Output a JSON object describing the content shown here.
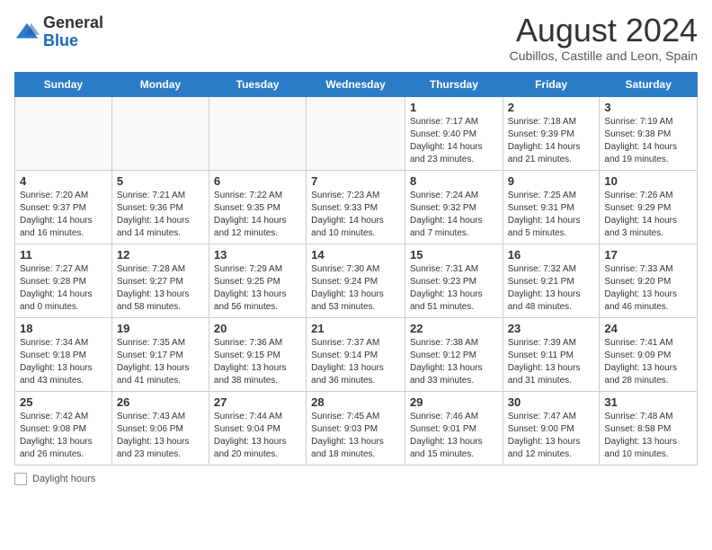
{
  "header": {
    "logo_general": "General",
    "logo_blue": "Blue",
    "month_year": "August 2024",
    "location": "Cubillos, Castille and Leon, Spain"
  },
  "days_of_week": [
    "Sunday",
    "Monday",
    "Tuesday",
    "Wednesday",
    "Thursday",
    "Friday",
    "Saturday"
  ],
  "weeks": [
    [
      {
        "day": "",
        "sunrise": "",
        "sunset": "",
        "daylight": ""
      },
      {
        "day": "",
        "sunrise": "",
        "sunset": "",
        "daylight": ""
      },
      {
        "day": "",
        "sunrise": "",
        "sunset": "",
        "daylight": ""
      },
      {
        "day": "",
        "sunrise": "",
        "sunset": "",
        "daylight": ""
      },
      {
        "day": "1",
        "sunrise": "Sunrise: 7:17 AM",
        "sunset": "Sunset: 9:40 PM",
        "daylight": "Daylight: 14 hours and 23 minutes."
      },
      {
        "day": "2",
        "sunrise": "Sunrise: 7:18 AM",
        "sunset": "Sunset: 9:39 PM",
        "daylight": "Daylight: 14 hours and 21 minutes."
      },
      {
        "day": "3",
        "sunrise": "Sunrise: 7:19 AM",
        "sunset": "Sunset: 9:38 PM",
        "daylight": "Daylight: 14 hours and 19 minutes."
      }
    ],
    [
      {
        "day": "4",
        "sunrise": "Sunrise: 7:20 AM",
        "sunset": "Sunset: 9:37 PM",
        "daylight": "Daylight: 14 hours and 16 minutes."
      },
      {
        "day": "5",
        "sunrise": "Sunrise: 7:21 AM",
        "sunset": "Sunset: 9:36 PM",
        "daylight": "Daylight: 14 hours and 14 minutes."
      },
      {
        "day": "6",
        "sunrise": "Sunrise: 7:22 AM",
        "sunset": "Sunset: 9:35 PM",
        "daylight": "Daylight: 14 hours and 12 minutes."
      },
      {
        "day": "7",
        "sunrise": "Sunrise: 7:23 AM",
        "sunset": "Sunset: 9:33 PM",
        "daylight": "Daylight: 14 hours and 10 minutes."
      },
      {
        "day": "8",
        "sunrise": "Sunrise: 7:24 AM",
        "sunset": "Sunset: 9:32 PM",
        "daylight": "Daylight: 14 hours and 7 minutes."
      },
      {
        "day": "9",
        "sunrise": "Sunrise: 7:25 AM",
        "sunset": "Sunset: 9:31 PM",
        "daylight": "Daylight: 14 hours and 5 minutes."
      },
      {
        "day": "10",
        "sunrise": "Sunrise: 7:26 AM",
        "sunset": "Sunset: 9:29 PM",
        "daylight": "Daylight: 14 hours and 3 minutes."
      }
    ],
    [
      {
        "day": "11",
        "sunrise": "Sunrise: 7:27 AM",
        "sunset": "Sunset: 9:28 PM",
        "daylight": "Daylight: 14 hours and 0 minutes."
      },
      {
        "day": "12",
        "sunrise": "Sunrise: 7:28 AM",
        "sunset": "Sunset: 9:27 PM",
        "daylight": "Daylight: 13 hours and 58 minutes."
      },
      {
        "day": "13",
        "sunrise": "Sunrise: 7:29 AM",
        "sunset": "Sunset: 9:25 PM",
        "daylight": "Daylight: 13 hours and 56 minutes."
      },
      {
        "day": "14",
        "sunrise": "Sunrise: 7:30 AM",
        "sunset": "Sunset: 9:24 PM",
        "daylight": "Daylight: 13 hours and 53 minutes."
      },
      {
        "day": "15",
        "sunrise": "Sunrise: 7:31 AM",
        "sunset": "Sunset: 9:23 PM",
        "daylight": "Daylight: 13 hours and 51 minutes."
      },
      {
        "day": "16",
        "sunrise": "Sunrise: 7:32 AM",
        "sunset": "Sunset: 9:21 PM",
        "daylight": "Daylight: 13 hours and 48 minutes."
      },
      {
        "day": "17",
        "sunrise": "Sunrise: 7:33 AM",
        "sunset": "Sunset: 9:20 PM",
        "daylight": "Daylight: 13 hours and 46 minutes."
      }
    ],
    [
      {
        "day": "18",
        "sunrise": "Sunrise: 7:34 AM",
        "sunset": "Sunset: 9:18 PM",
        "daylight": "Daylight: 13 hours and 43 minutes."
      },
      {
        "day": "19",
        "sunrise": "Sunrise: 7:35 AM",
        "sunset": "Sunset: 9:17 PM",
        "daylight": "Daylight: 13 hours and 41 minutes."
      },
      {
        "day": "20",
        "sunrise": "Sunrise: 7:36 AM",
        "sunset": "Sunset: 9:15 PM",
        "daylight": "Daylight: 13 hours and 38 minutes."
      },
      {
        "day": "21",
        "sunrise": "Sunrise: 7:37 AM",
        "sunset": "Sunset: 9:14 PM",
        "daylight": "Daylight: 13 hours and 36 minutes."
      },
      {
        "day": "22",
        "sunrise": "Sunrise: 7:38 AM",
        "sunset": "Sunset: 9:12 PM",
        "daylight": "Daylight: 13 hours and 33 minutes."
      },
      {
        "day": "23",
        "sunrise": "Sunrise: 7:39 AM",
        "sunset": "Sunset: 9:11 PM",
        "daylight": "Daylight: 13 hours and 31 minutes."
      },
      {
        "day": "24",
        "sunrise": "Sunrise: 7:41 AM",
        "sunset": "Sunset: 9:09 PM",
        "daylight": "Daylight: 13 hours and 28 minutes."
      }
    ],
    [
      {
        "day": "25",
        "sunrise": "Sunrise: 7:42 AM",
        "sunset": "Sunset: 9:08 PM",
        "daylight": "Daylight: 13 hours and 26 minutes."
      },
      {
        "day": "26",
        "sunrise": "Sunrise: 7:43 AM",
        "sunset": "Sunset: 9:06 PM",
        "daylight": "Daylight: 13 hours and 23 minutes."
      },
      {
        "day": "27",
        "sunrise": "Sunrise: 7:44 AM",
        "sunset": "Sunset: 9:04 PM",
        "daylight": "Daylight: 13 hours and 20 minutes."
      },
      {
        "day": "28",
        "sunrise": "Sunrise: 7:45 AM",
        "sunset": "Sunset: 9:03 PM",
        "daylight": "Daylight: 13 hours and 18 minutes."
      },
      {
        "day": "29",
        "sunrise": "Sunrise: 7:46 AM",
        "sunset": "Sunset: 9:01 PM",
        "daylight": "Daylight: 13 hours and 15 minutes."
      },
      {
        "day": "30",
        "sunrise": "Sunrise: 7:47 AM",
        "sunset": "Sunset: 9:00 PM",
        "daylight": "Daylight: 13 hours and 12 minutes."
      },
      {
        "day": "31",
        "sunrise": "Sunrise: 7:48 AM",
        "sunset": "Sunset: 8:58 PM",
        "daylight": "Daylight: 13 hours and 10 minutes."
      }
    ]
  ],
  "footer": {
    "daylight_label": "Daylight hours"
  }
}
